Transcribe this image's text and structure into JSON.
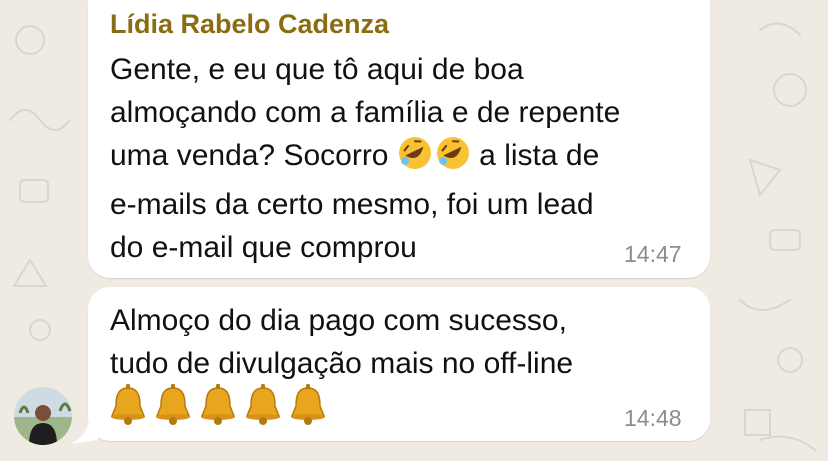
{
  "chat": {
    "messages": [
      {
        "sender": "Lídia Rabelo Cadenza",
        "text_part1": "Gente, e eu que tô aqui de boa\nalmoçando com a família e de repente\numa venda? Socorro ",
        "emoji_name": "rolling-on-floor-laughing-emoji",
        "emoji_count": 2,
        "text_part2": " a lista de\ne-mails da certo mesmo, foi um lead\ndo e-mail que comprou",
        "time": "14:47"
      },
      {
        "text": "Almoço do dia pago com sucesso,\ntudo de divulgação mais no off-line",
        "emoji_name": "bell-emoji",
        "emoji_count": 5,
        "time": "14:48"
      }
    ],
    "avatar_icon": "contact-avatar-photo",
    "colors": {
      "background": "#efeae2",
      "bubble": "#ffffff",
      "sender_name": "#8a6d12",
      "timestamp": "#8c8c8c"
    }
  }
}
